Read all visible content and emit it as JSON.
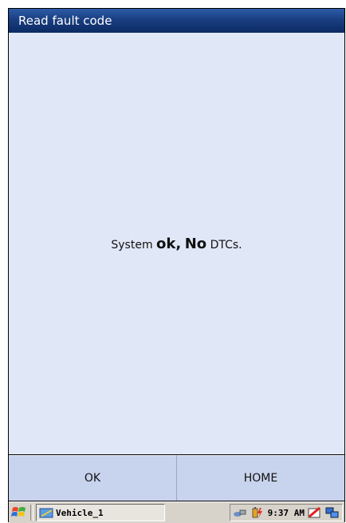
{
  "window": {
    "title": "Read fault code"
  },
  "message": {
    "prefix": "System",
    "ok": "ok,",
    "no": "No",
    "suffix": "DTCs."
  },
  "buttons": {
    "ok_label": "OK",
    "home_label": "HOME"
  },
  "taskbar": {
    "task_label": "Vehicle_1",
    "clock": "9:37 AM"
  },
  "icons": {
    "start": "windows-flag-icon",
    "task": "vehicle-app-icon",
    "tray": [
      "network-icon",
      "battery-icon",
      "sync-icon",
      "desktop-icon"
    ]
  },
  "colors": {
    "titlebar": "#1a3e80",
    "content": "#e0e8f8",
    "button": "#c8d3ed",
    "taskbar": "#d7d3cb"
  }
}
